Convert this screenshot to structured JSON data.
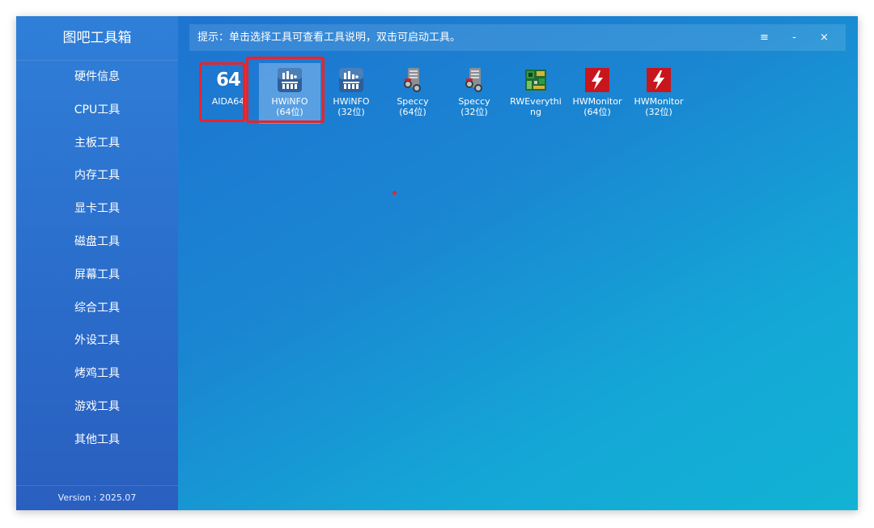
{
  "app": {
    "title": "图吧工具箱",
    "version": "Version : 2025.07"
  },
  "sidebar": {
    "items": [
      {
        "label": "硬件信息"
      },
      {
        "label": "CPU工具"
      },
      {
        "label": "主板工具"
      },
      {
        "label": "内存工具"
      },
      {
        "label": "显卡工具"
      },
      {
        "label": "磁盘工具"
      },
      {
        "label": "屏幕工具"
      },
      {
        "label": "综合工具"
      },
      {
        "label": "外设工具"
      },
      {
        "label": "烤鸡工具"
      },
      {
        "label": "游戏工具"
      },
      {
        "label": "其他工具"
      }
    ]
  },
  "topbar": {
    "hint": "提示：单击选择工具可查看工具说明，双击可启动工具。",
    "menu_glyph": "≡",
    "minimize_glyph": "-",
    "close_glyph": "×"
  },
  "tools": [
    {
      "label": "AIDA64",
      "icon": "aida64-icon",
      "icon_text": "64",
      "selected": false,
      "highlighted": true
    },
    {
      "label": "HWiNFO\n(64位)",
      "icon": "hwinfo-icon",
      "selected": true,
      "highlighted": true
    },
    {
      "label": "HWiNFO\n(32位)",
      "icon": "hwinfo-icon",
      "selected": false,
      "highlighted": false
    },
    {
      "label": "Speccy\n(64位)",
      "icon": "speccy-icon",
      "selected": false,
      "highlighted": false
    },
    {
      "label": "Speccy\n(32位)",
      "icon": "speccy-icon",
      "selected": false,
      "highlighted": false
    },
    {
      "label": "RWEverythi\nng",
      "icon": "rweverything-icon",
      "selected": false,
      "highlighted": false
    },
    {
      "label": "HWMonitor\n(64位)",
      "icon": "hwmonitor-icon",
      "selected": false,
      "highlighted": false
    },
    {
      "label": "HWMonitor\n(32位)",
      "icon": "hwmonitor-icon",
      "selected": false,
      "highlighted": false
    }
  ],
  "colors": {
    "accent_red": "#e8242a",
    "hwmonitor_red": "#c8161d",
    "hwinfo_blue": "#2e5f9a"
  }
}
